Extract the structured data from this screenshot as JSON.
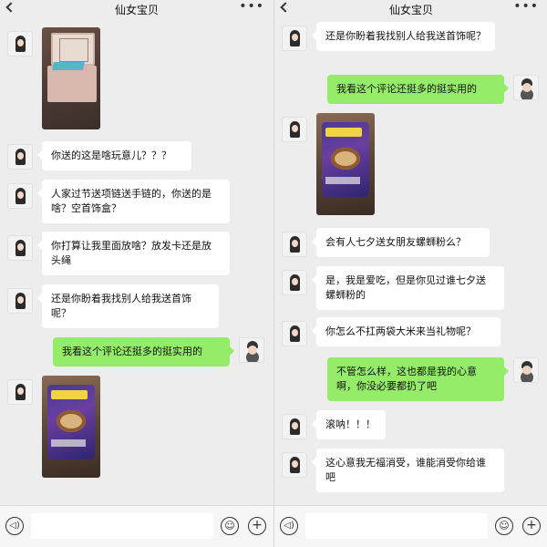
{
  "chat_title": "仙女宝贝",
  "more_symbol": "•••",
  "input_placeholder": "",
  "icons": {
    "voice": "voice-icon",
    "emoji": "emoji-icon",
    "plus": "plus-icon",
    "back": "back-icon",
    "more": "more-icon"
  },
  "icon_glyphs": {
    "voice": "◁)",
    "emoji": "☺",
    "plus": "+"
  },
  "colors": {
    "background": "#ededed",
    "sent_bubble": "#95ec69",
    "received_bubble": "#ffffff"
  },
  "left_panel": {
    "messages": [
      {
        "from": "her",
        "type": "image",
        "subject": "jewelry box"
      },
      {
        "from": "her",
        "type": "text",
        "text": "你送的这是啥玩意儿？？？"
      },
      {
        "from": "her",
        "type": "text",
        "text": "人家过节送项链送手链的，你送的是啥？空首饰盒？"
      },
      {
        "from": "her",
        "type": "text",
        "text": "你打算让我里面放啥？放发卡还是放头绳"
      },
      {
        "from": "her",
        "type": "text",
        "text": "还是你盼着我找别人给我送首饰呢？"
      },
      {
        "from": "me",
        "type": "text",
        "text": "我看这个评论还挺多的挺实用的"
      },
      {
        "from": "her",
        "type": "image",
        "subject": "snail noodle bag"
      }
    ]
  },
  "right_panel": {
    "messages": [
      {
        "from": "her",
        "type": "text",
        "text": "还是你盼着我找别人给我送首饰呢？"
      },
      {
        "from": "me",
        "type": "text",
        "text": "我看这个评论还挺多的挺实用的"
      },
      {
        "from": "her",
        "type": "image",
        "subject": "snail noodle bag"
      },
      {
        "from": "her",
        "type": "text",
        "text": "会有人七夕送女朋友螺蛳粉么？"
      },
      {
        "from": "her",
        "type": "text",
        "text": "是，我是爱吃，但是你见过谁七夕送螺蛳粉的"
      },
      {
        "from": "her",
        "type": "text",
        "text": "你怎么不扛两袋大米来当礼物呢？"
      },
      {
        "from": "me",
        "type": "text",
        "text": "不管怎么样，这也都是我的心意啊，你没必要都扔了吧"
      },
      {
        "from": "her",
        "type": "text",
        "text": "滚呐！！！"
      },
      {
        "from": "her",
        "type": "text",
        "text": "这心意我无福消受，谁能消受你给谁吧"
      }
    ]
  }
}
